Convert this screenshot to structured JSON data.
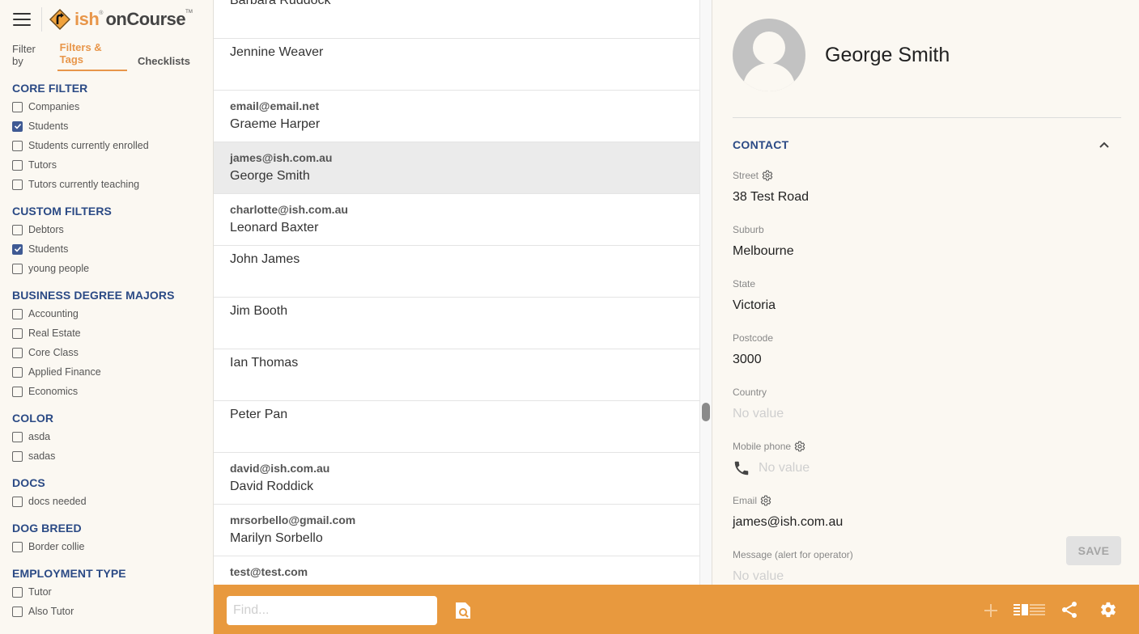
{
  "app": {
    "logo_ish": "ish",
    "logo_reg": "®",
    "logo_course": "onCourse",
    "logo_tm": "TM"
  },
  "sidebar": {
    "filter_by_label": "Filter by",
    "tabs": [
      {
        "label": "Filters & Tags",
        "active": true
      },
      {
        "label": "Checklists",
        "active": false
      }
    ],
    "groups": [
      {
        "title": "CORE FILTER",
        "items": [
          {
            "label": "Companies",
            "checked": false
          },
          {
            "label": "Students",
            "checked": true
          },
          {
            "label": "Students currently enrolled",
            "checked": false
          },
          {
            "label": "Tutors",
            "checked": false
          },
          {
            "label": "Tutors currently teaching",
            "checked": false
          }
        ]
      },
      {
        "title": "CUSTOM FILTERS",
        "items": [
          {
            "label": "Debtors",
            "checked": false
          },
          {
            "label": "Students",
            "checked": true
          },
          {
            "label": "young people",
            "checked": false
          }
        ]
      },
      {
        "title": "BUSINESS DEGREE MAJORS",
        "items": [
          {
            "label": "Accounting",
            "checked": false
          },
          {
            "label": "Real Estate",
            "checked": false
          },
          {
            "label": "Core Class",
            "checked": false
          },
          {
            "label": "Applied Finance",
            "checked": false
          },
          {
            "label": "Economics",
            "checked": false
          }
        ]
      },
      {
        "title": "COLOR",
        "items": [
          {
            "label": "asda",
            "checked": false
          },
          {
            "label": "sadas",
            "checked": false
          }
        ]
      },
      {
        "title": "DOCS",
        "items": [
          {
            "label": "docs needed",
            "checked": false
          }
        ]
      },
      {
        "title": "DOG BREED",
        "items": [
          {
            "label": "Border collie",
            "checked": false
          }
        ]
      },
      {
        "title": "EMPLOYMENT TYPE",
        "items": [
          {
            "label": "Tutor",
            "checked": false
          },
          {
            "label": "Also Tutor",
            "checked": false
          }
        ]
      }
    ]
  },
  "list": {
    "items": [
      {
        "email": "",
        "name": "Barbara Ruddock",
        "selected": false
      },
      {
        "email": "",
        "name": "Jennine Weaver",
        "selected": false
      },
      {
        "email": "email@email.net",
        "name": "Graeme Harper",
        "selected": false
      },
      {
        "email": "james@ish.com.au",
        "name": "George Smith",
        "selected": true
      },
      {
        "email": "charlotte@ish.com.au",
        "name": "Leonard Baxter",
        "selected": false
      },
      {
        "email": "",
        "name": "John James",
        "selected": false
      },
      {
        "email": "",
        "name": "Jim Booth",
        "selected": false
      },
      {
        "email": "",
        "name": "Ian Thomas",
        "selected": false
      },
      {
        "email": "",
        "name": "Peter Pan",
        "selected": false
      },
      {
        "email": "david@ish.com.au",
        "name": "David Roddick",
        "selected": false
      },
      {
        "email": "mrsorbello@gmail.com",
        "name": "Marilyn Sorbello",
        "selected": false
      },
      {
        "email": "test@test.com",
        "name": "",
        "selected": false
      }
    ]
  },
  "detail": {
    "name": "George Smith",
    "section_title": "CONTACT",
    "fields": [
      {
        "label": "Street",
        "value": "38 Test Road",
        "has_gear": true,
        "empty": false
      },
      {
        "label": "Suburb",
        "value": "Melbourne",
        "has_gear": false,
        "empty": false
      },
      {
        "label": "State",
        "value": "Victoria",
        "has_gear": false,
        "empty": false
      },
      {
        "label": "Postcode",
        "value": "3000",
        "has_gear": false,
        "empty": false
      },
      {
        "label": "Country",
        "value": "No value",
        "has_gear": false,
        "empty": true
      },
      {
        "label": "Mobile phone",
        "value": "No value",
        "has_gear": true,
        "empty": true,
        "phone_icon": true
      },
      {
        "label": "Email",
        "value": "james@ish.com.au",
        "has_gear": true,
        "empty": false
      },
      {
        "label": "Message (alert for operator)",
        "value": "No value",
        "has_gear": false,
        "empty": true
      }
    ],
    "save_label": "SAVE"
  },
  "bottombar": {
    "find_placeholder": "Find...",
    "find_value": ""
  },
  "colors": {
    "accent_orange": "#e8993e",
    "heading_blue": "#2b4a85",
    "checkbox_blue": "#3f5a94",
    "background_cream": "#fbf8f2"
  }
}
